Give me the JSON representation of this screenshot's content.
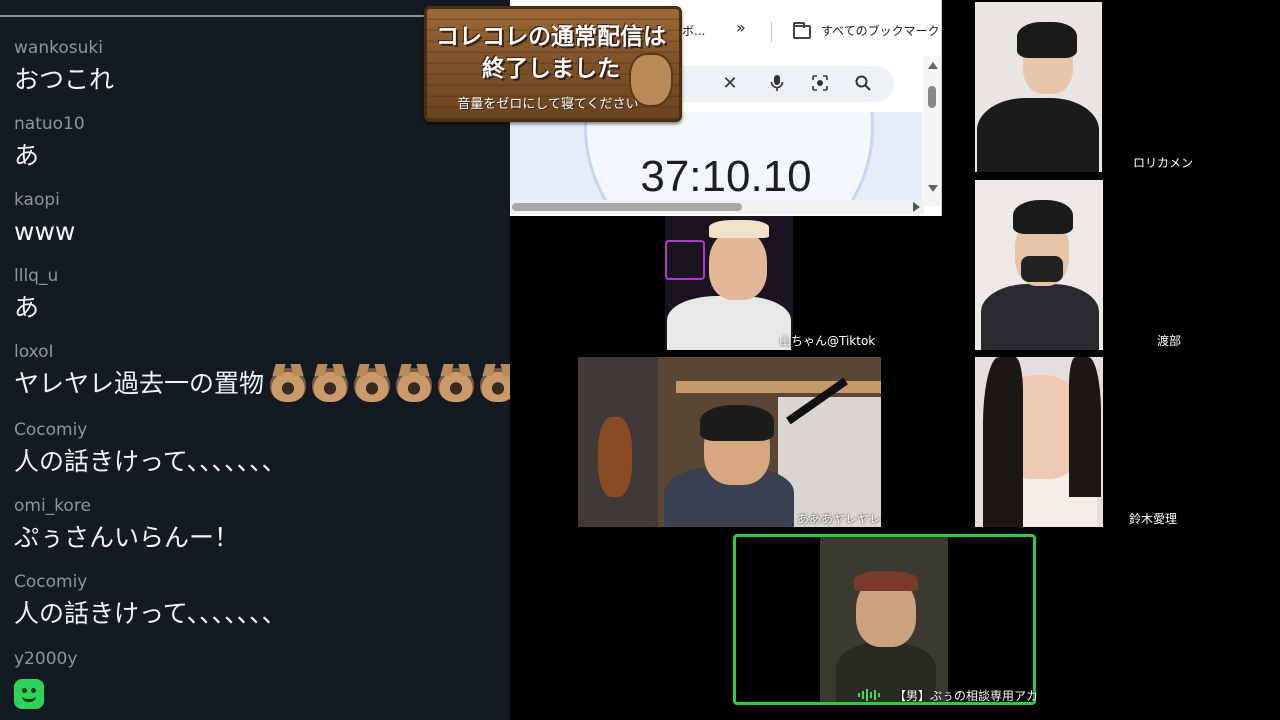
{
  "chat": {
    "messages": [
      {
        "user": "wankosuki",
        "text": "おつこれ"
      },
      {
        "user": "natuo10",
        "text": "あ"
      },
      {
        "user": "kaopi",
        "text": "www"
      },
      {
        "user": "lllq_u",
        "text": "あ"
      },
      {
        "user": "loxoI",
        "text": "ヤレヤレ過去一の置物"
      },
      {
        "user": "Cocomiy",
        "text": "人の話きけって、、、、、、、"
      },
      {
        "user": "omi_kore",
        "text": "ぷぅさんいらんー！"
      },
      {
        "user": "Cocomiy",
        "text": "人の話きけって、、、、、、、"
      },
      {
        "user": "y2000y",
        "text": ""
      }
    ]
  },
  "browser": {
    "bookmark_partial": "ボ...",
    "more_bookmarks": "»",
    "all_bookmarks": "すべてのブックマーク",
    "timer": "37:10.10",
    "icons": {
      "clear": "✕",
      "mic": "mic-icon",
      "lens": "lens-icon",
      "search": "search-icon"
    }
  },
  "sign": {
    "line1": "コレコレの通常配信は",
    "line2": "終了しました",
    "line3": "音量をゼロにして寝てください"
  },
  "participants": [
    {
      "name": "ロリカメン"
    },
    {
      "name": "山ちゃん@Tiktok"
    },
    {
      "name": "渡部"
    },
    {
      "name": "あああヤレヤレ"
    },
    {
      "name": "鈴木愛理"
    },
    {
      "name": "【男】ぷぅの相談専用アカ"
    }
  ],
  "colors": {
    "active_speaker_border": "#2ecc40",
    "chat_bg": "#141a22"
  }
}
